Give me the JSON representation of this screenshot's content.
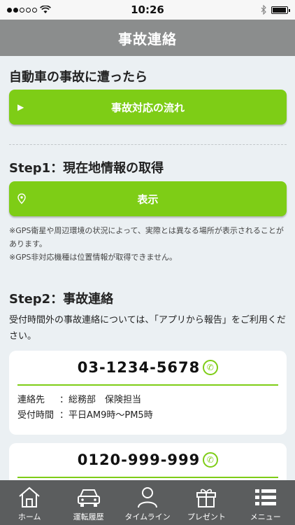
{
  "status_bar": {
    "time": "10:26",
    "signal_dots_filled": 2,
    "signal_dots_total": 5,
    "battery_level": 0.95
  },
  "header": {
    "title": "事故連絡"
  },
  "section1": {
    "title": "自動車の事故に遭ったら",
    "button_label": "事故対応の流れ"
  },
  "step1": {
    "title": "Step1：現在地情報の取得",
    "button_label": "表示",
    "note1": "※GPS衛星や周辺環境の状況によって、実際とは異なる場所が表示されることがあります。",
    "note2": "※GPS非対応機種は位置情報が取得できません。"
  },
  "step2": {
    "title": "Step2：事故連絡",
    "description": "受付時間外の事故連絡については、「アプリから報告」をご利用ください。"
  },
  "contacts": [
    {
      "phone": "03-1234-5678",
      "label1": "連絡先",
      "value1": "：総務部　保険担当",
      "label2": "受付時間",
      "value2": "：平日AM9時〜PM5時"
    },
    {
      "phone": "0120-999-999"
    }
  ],
  "tab_bar": {
    "items": [
      {
        "label": "ホーム",
        "icon": "home-icon"
      },
      {
        "label": "運転履歴",
        "icon": "car-icon"
      },
      {
        "label": "タイムライン",
        "icon": "person-icon"
      },
      {
        "label": "プレゼント",
        "icon": "gift-icon"
      },
      {
        "label": "メニュー",
        "icon": "menu-icon"
      }
    ]
  },
  "colors": {
    "accent": "#7ecd16",
    "header_bg": "#8b8d8d",
    "tab_bar_bg": "#5b5d5e",
    "page_bg": "#ebf0f3"
  }
}
